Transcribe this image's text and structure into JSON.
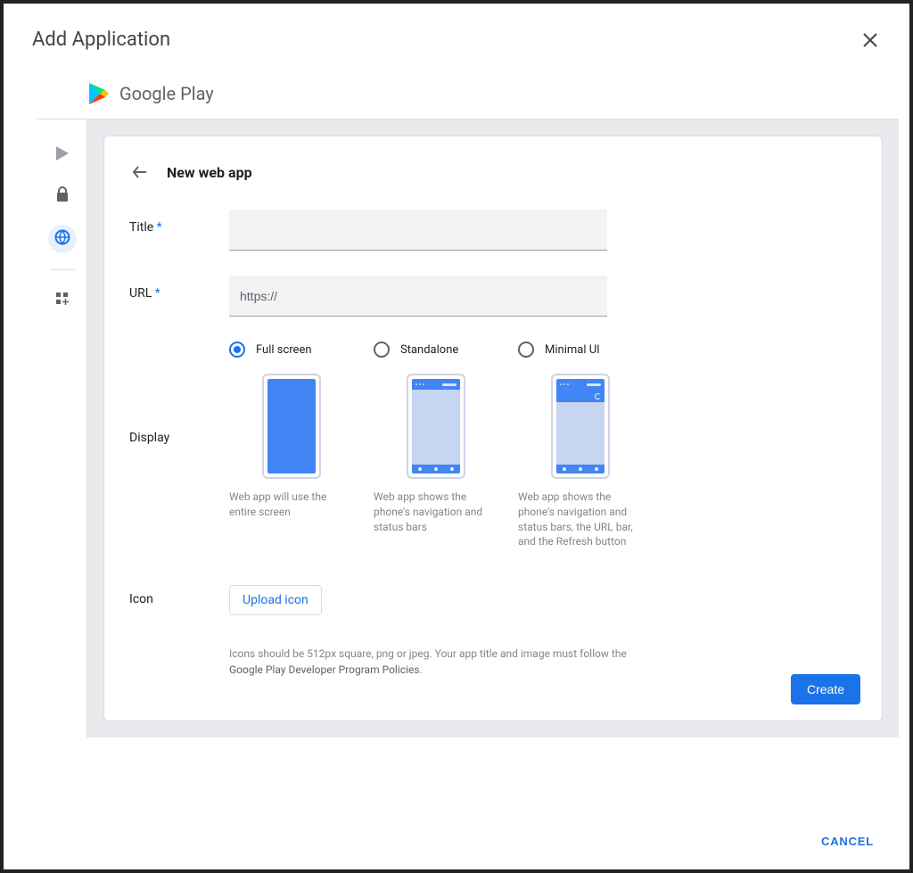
{
  "modal": {
    "title": "Add Application",
    "cancel_label": "CANCEL"
  },
  "play_header": {
    "brand": "Google Play"
  },
  "page": {
    "title": "New web app"
  },
  "form": {
    "title_label": "Title",
    "url_label": "URL",
    "url_value": "https://",
    "display_label": "Display",
    "icon_label": "Icon",
    "upload_label": "Upload icon",
    "icon_info_prefix": "Icons should be 512px square, png or jpeg. Your app title and image must follow the ",
    "policy_link": "Google Play Developer Program Policies",
    "icon_info_suffix": ".",
    "create_label": "Create"
  },
  "display_options": {
    "fullscreen": {
      "label": "Full screen",
      "desc": "Web app will use the entire screen"
    },
    "standalone": {
      "label": "Standalone",
      "desc": "Web app shows the phone's navigation and status bars"
    },
    "minimal": {
      "label": "Minimal UI",
      "desc": "Web app shows the phone's navigation and status bars, the URL bar, and the Refresh button"
    }
  }
}
